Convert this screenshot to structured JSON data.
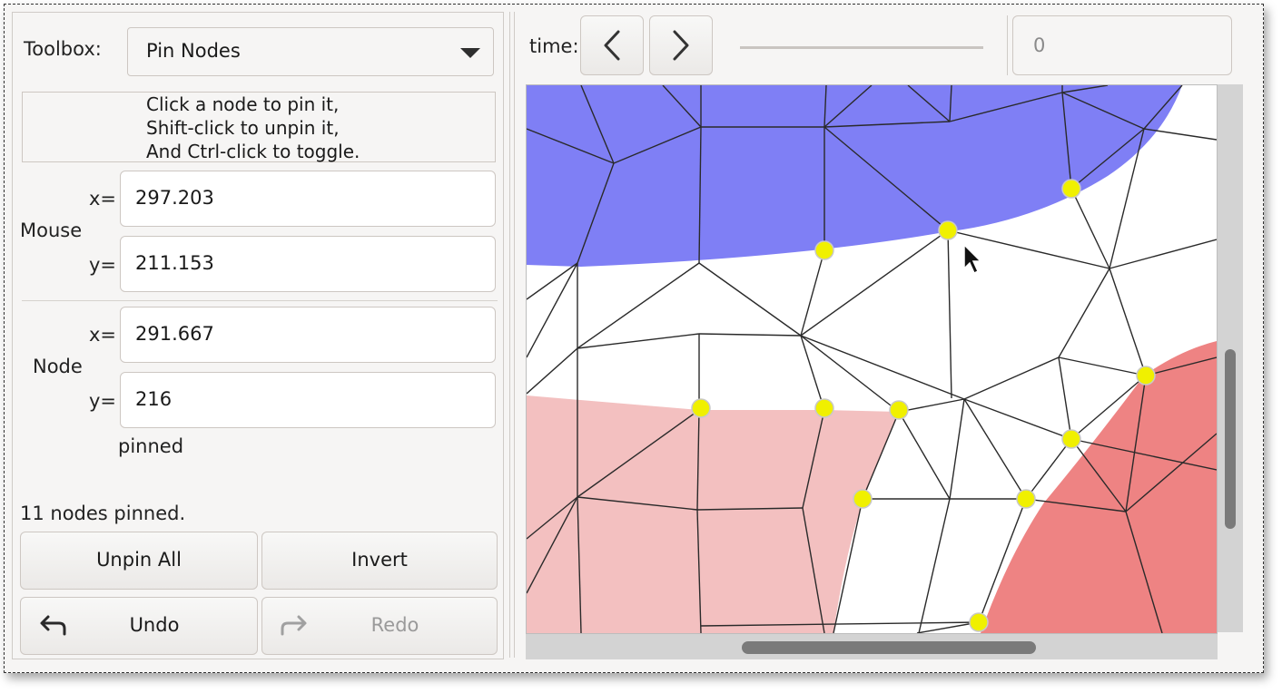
{
  "toolbox": {
    "label": "Toolbox:",
    "selected": "Pin Nodes"
  },
  "hint": {
    "lines": [
      "Click a node to pin it,",
      "Shift-click to unpin it,",
      "And Ctrl-click to toggle."
    ]
  },
  "mouse": {
    "label": "Mouse",
    "x_label": "x=",
    "y_label": "y=",
    "x": "297.203",
    "y": "211.153"
  },
  "node": {
    "label": "Node",
    "x_label": "x=",
    "y_label": "y=",
    "x": "291.667",
    "y": "216",
    "status": "pinned"
  },
  "pinned_count_text": "11 nodes pinned.",
  "buttons": {
    "unpin_all": "Unpin All",
    "invert": "Invert",
    "undo": "Undo",
    "redo": "Redo"
  },
  "time": {
    "label": "time:",
    "value": "0"
  },
  "colors": {
    "blue_region": "#7f7ff5",
    "light_red_region": "#f3c0c0",
    "red_region": "#ee8383",
    "pinned_node": "#f0f000",
    "mesh_edge": "#2a2a2a"
  },
  "icons": {
    "prev": "chevron-left-icon",
    "next": "chevron-right-icon",
    "undo": "undo-arrow-icon",
    "redo": "redo-arrow-icon",
    "dropdown": "triangle-down-icon",
    "cursor": "mouse-pointer-icon"
  }
}
